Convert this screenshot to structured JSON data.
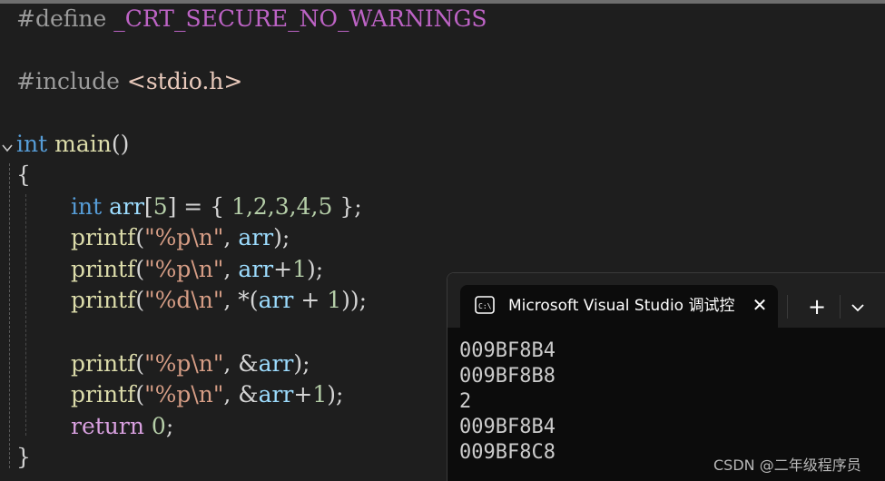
{
  "editor": {
    "line1": {
      "directive": "#define",
      "macro": "_CRT_SECURE_NO_WARNINGS"
    },
    "line2": {
      "directive": "#include",
      "header": "<stdio.h>"
    },
    "line3": {
      "kw": "int",
      "name": "main",
      "parens": "()"
    },
    "line4": {
      "brace": "{"
    },
    "line5": {
      "kw": "int",
      "var": "arr",
      "b1": "[",
      "n5": "5",
      "rest1": "] = { ",
      "values": "1,2,3,4,5",
      "rest2": " };"
    },
    "line6": {
      "fn": "printf",
      "open": "(",
      "str": "\"%p\\n\"",
      "comma": ", ",
      "arg": "arr",
      "close": ");"
    },
    "line7": {
      "fn": "printf",
      "open": "(",
      "str": "\"%p\\n\"",
      "comma": ", ",
      "arg": "arr",
      "plus": "+",
      "one": "1",
      "close": ");"
    },
    "line8": {
      "fn": "printf",
      "open": "(",
      "str": "\"%d\\n\"",
      "comma": ", *(",
      "arg": "arr",
      "plus": " + ",
      "one": "1",
      "close": "));"
    },
    "line9": {
      "fn": "printf",
      "open": "(",
      "str": "\"%p\\n\"",
      "comma": ", &",
      "arg": "arr",
      "close": ");"
    },
    "line10": {
      "fn": "printf",
      "open": "(",
      "str": "\"%p\\n\"",
      "comma": ", &",
      "arg": "arr",
      "plus": "+",
      "one": "1",
      "close": ");"
    },
    "line11": {
      "kw": "return",
      "space": " ",
      "num": "0",
      "semi": ";"
    },
    "line12": {
      "brace": "}"
    }
  },
  "terminal": {
    "tab_title": "Microsoft Visual Studio 调试控",
    "close_glyph": "✕",
    "newtab_glyph": "+",
    "output": [
      "009BF8B4",
      "009BF8B8",
      "2",
      "009BF8B4",
      "009BF8C8"
    ]
  },
  "watermark": "CSDN @二年级程序员"
}
